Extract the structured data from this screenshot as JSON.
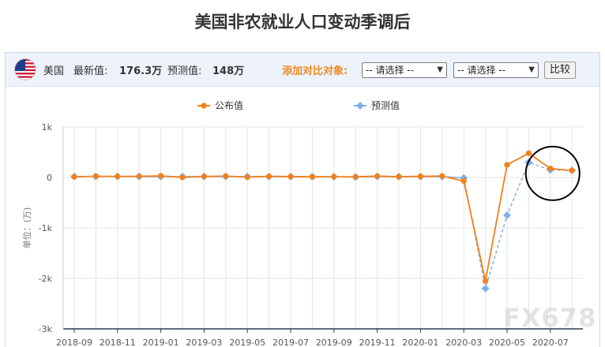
{
  "page_title": "美国非农就业人口变动季调后",
  "toolbar": {
    "country": "美国",
    "latest_label": "最新值:",
    "latest_value": "176.3万",
    "forecast_label": "预测值:",
    "forecast_value": "148万",
    "compare_label": "添加对比对象:",
    "select1": "-- 请选择 --",
    "select2": "-- 请选择 --",
    "compare_button": "比较"
  },
  "watermark": "FX678",
  "colors": {
    "actual": "#f57f17",
    "forecast": "#7fb1e8",
    "grid": "#e4e4e4",
    "axis": "#2b3a55",
    "highlight_circle": "#000000"
  },
  "chart_data": {
    "type": "line",
    "ylabel": "单位：(万)",
    "ylim": [
      -3000,
      1000
    ],
    "yticks": [
      1000,
      0,
      -1000,
      -2000,
      -3000
    ],
    "ytick_labels": [
      "1k",
      "0",
      "-1k",
      "-2k",
      "-3k"
    ],
    "xtick_labels": [
      "2018-09",
      "2018-11",
      "2019-01",
      "2019-03",
      "2019-05",
      "2019-07",
      "2019-09",
      "2019-11",
      "2020-01",
      "2020-03",
      "2020-05",
      "2020-07"
    ],
    "categories": [
      "2018-09",
      "2018-10",
      "2018-11",
      "2018-12",
      "2019-01",
      "2019-02",
      "2019-03",
      "2019-04",
      "2019-05",
      "2019-06",
      "2019-07",
      "2019-08",
      "2019-09",
      "2019-10",
      "2019-11",
      "2019-12",
      "2020-01",
      "2020-02",
      "2020-03",
      "2020-04",
      "2020-05",
      "2020-06",
      "2020-07",
      "2020-08"
    ],
    "legend_position": "top",
    "grid": true,
    "series": [
      {
        "name": "公布值",
        "color": "#f57f17",
        "values": [
          11.8,
          25,
          19.6,
          22.7,
          31.2,
          2,
          19.6,
          26.3,
          7.5,
          22.4,
          16.4,
          13,
          13.6,
          12.8,
          26.6,
          14.5,
          22.5,
          27.3,
          -70.1,
          -2050,
          250.9,
          480,
          176.3,
          137.1
        ]
      },
      {
        "name": "预测值",
        "color": "#7fb1e8",
        "values": [
          18.5,
          19,
          19.8,
          18.4,
          16.5,
          18,
          17.5,
          18.1,
          18.5,
          16,
          16.5,
          16,
          14.5,
          8.5,
          18,
          16,
          16,
          17.5,
          -10,
          -2200,
          -750,
          300,
          148,
          140
        ]
      }
    ],
    "highlight": {
      "from": "2020-06",
      "to": "2020-08"
    }
  }
}
